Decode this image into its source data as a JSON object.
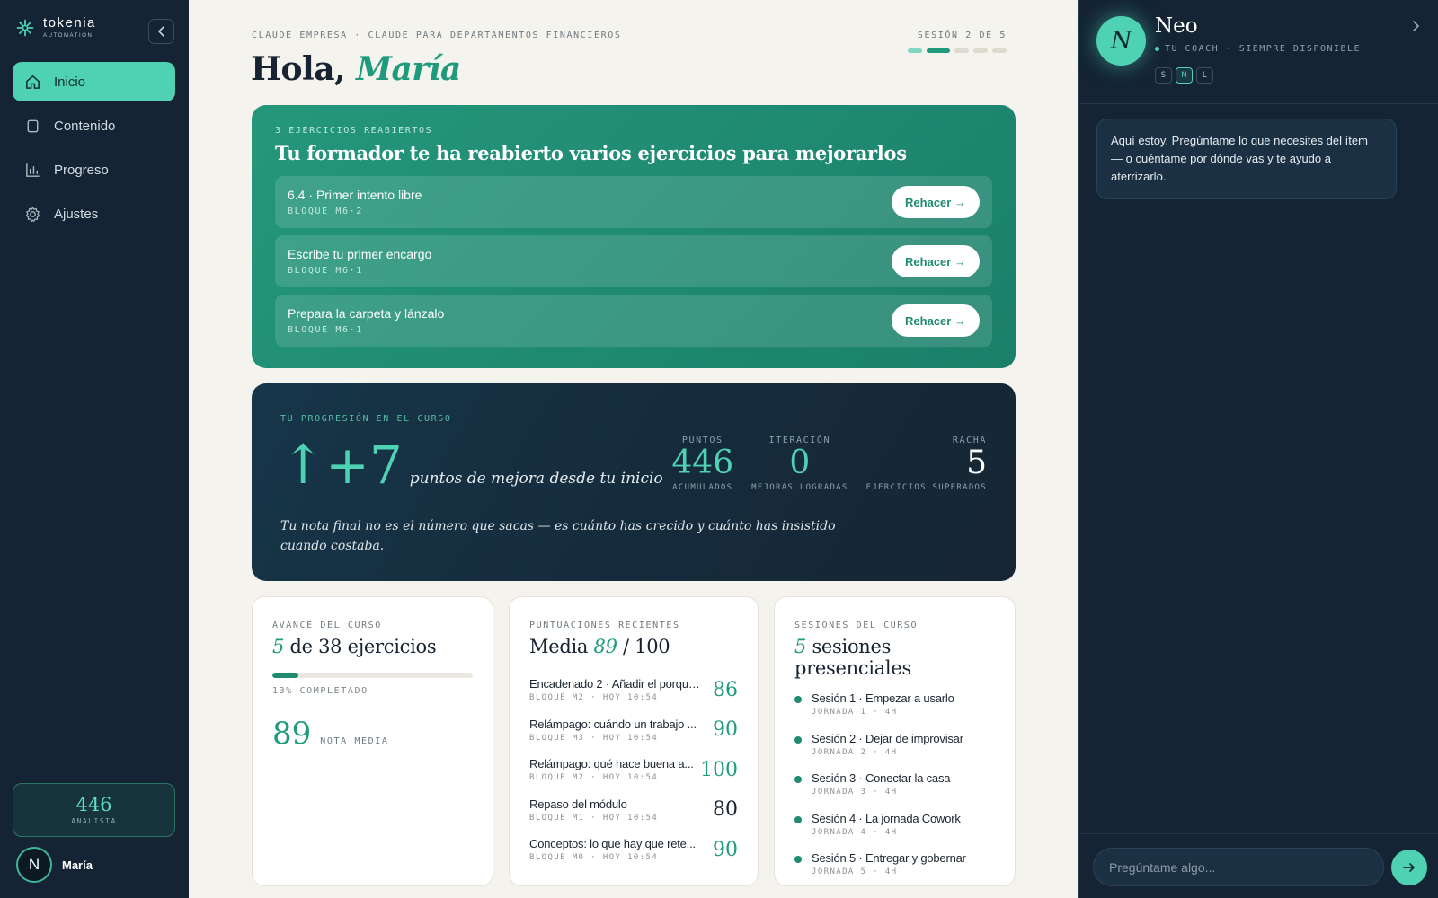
{
  "sidebar": {
    "logo": {
      "name": "tokenia",
      "sub": "AUTOMATION"
    },
    "items": [
      {
        "label": "Inicio",
        "icon": "home-icon",
        "active": true
      },
      {
        "label": "Contenido",
        "icon": "square-icon",
        "active": false
      },
      {
        "label": "Progreso",
        "icon": "bar-chart-icon",
        "active": false
      },
      {
        "label": "Ajustes",
        "icon": "gear-icon",
        "active": false
      }
    ],
    "score": {
      "value": "446",
      "label": "ANALISTA"
    },
    "user": {
      "initial": "N",
      "name": "María"
    }
  },
  "header": {
    "eyebrow": "CLAUDE EMPRESA · CLAUDE PARA DEPARTAMENTOS FINANCIEROS",
    "greeting": "Hola,",
    "name": "María",
    "session_label": "SESIÓN 2 DE 5",
    "session_current": 2,
    "session_total": 5
  },
  "reopened": {
    "eyebrow": "3 EJERCICIOS REABIERTOS",
    "title": "Tu formador te ha reabierto varios ejercicios para mejorarlos",
    "button_label": "Rehacer →",
    "items": [
      {
        "name": "6.4 · Primer intento libre",
        "block": "BLOQUE M6·2"
      },
      {
        "name": "Escribe tu primer encargo",
        "block": "BLOQUE M6·1"
      },
      {
        "name": "Prepara la carpeta y lánzalo",
        "block": "BLOQUE M6·1"
      }
    ]
  },
  "progression": {
    "eyebrow": "TU PROGRESIÓN EN EL CURSO",
    "arrow": "↑",
    "delta": "+7",
    "caption": "puntos de mejora desde tu inicio",
    "stats": [
      {
        "top": "PUNTOS",
        "value": "446",
        "bottom": "ACUMULADOS"
      },
      {
        "top": "ITERACIÓN",
        "value": "0",
        "bottom": "MEJORAS LOGRADAS"
      },
      {
        "top": "RACHA",
        "value": "5",
        "bottom": "EJERCICIOS SUPERADOS"
      }
    ],
    "quote": "Tu nota final no es el número que sacas — es cuánto has crecido y cuánto has insistido cuando costaba."
  },
  "course_progress": {
    "eyebrow": "AVANCE DEL CURSO",
    "done": "5",
    "total_text": "de 38 ejercicios",
    "percent": 13,
    "percent_label": "13% COMPLETADO",
    "average": "89",
    "average_label": "NOTA MEDIA"
  },
  "recent_scores": {
    "eyebrow": "PUNTUACIONES RECIENTES",
    "title_prefix": "Media",
    "average": "89",
    "title_suffix": "/ 100",
    "items": [
      {
        "name": "Encadenado 2 · Añadir el porqué...",
        "meta": "BLOQUE M2 · HOY 10:54",
        "score": "86"
      },
      {
        "name": "Relámpago: cuándo un trabajo ...",
        "meta": "BLOQUE M3 · HOY 10:54",
        "score": "90"
      },
      {
        "name": "Relámpago: qué hace buena a...",
        "meta": "BLOQUE M2 · HOY 10:54",
        "score": "100"
      },
      {
        "name": "Repaso del módulo",
        "meta": "BLOQUE M1 · HOY 10:54",
        "score": "80"
      },
      {
        "name": "Conceptos: lo que hay que rete...",
        "meta": "BLOQUE M0 · HOY 10:54",
        "score": "90"
      }
    ]
  },
  "sessions": {
    "eyebrow": "SESIONES DEL CURSO",
    "count": "5",
    "title": "sesiones presenciales",
    "items": [
      {
        "name": "Sesión 1 · Empezar a usarlo",
        "meta": "JORNADA 1 · 4H"
      },
      {
        "name": "Sesión 2 · Dejar de improvisar",
        "meta": "JORNADA 2 · 4H"
      },
      {
        "name": "Sesión 3 · Conectar la casa",
        "meta": "JORNADA 3 · 4H"
      },
      {
        "name": "Sesión 4 · La jornada Cowork",
        "meta": "JORNADA 4 · 4H"
      },
      {
        "name": "Sesión 5 · Entregar y gobernar",
        "meta": "JORNADA 5 · 4H"
      }
    ]
  },
  "coach": {
    "initial": "N",
    "name": "Neo",
    "subtitle": "TU COACH · SIEMPRE DISPONIBLE",
    "sizes": [
      "S",
      "M",
      "L"
    ],
    "active_size": "M",
    "message": "Aquí estoy. Pregúntame lo que necesites del ítem — o cuéntame por dónde vas y te ayudo a aterrizarlo.",
    "input_placeholder": "Pregúntame algo..."
  },
  "colors": {
    "accent": "#4fd1b3",
    "brand_green": "#1f9a7a",
    "sidebar_bg": "#142434",
    "page_bg": "#f5f3ee"
  }
}
